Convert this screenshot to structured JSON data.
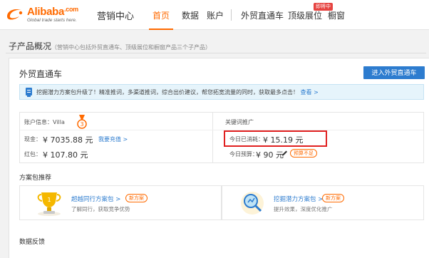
{
  "header": {
    "logo_text": "Alibaba",
    "logo_suffix": ".com",
    "logo_tagline": "Global trade starts here.",
    "app_name": "营销中心",
    "nav": [
      {
        "label": "首页",
        "active": true
      },
      {
        "label": "数据",
        "active": false
      },
      {
        "label": "账户",
        "active": false
      },
      {
        "label": "外贸直通车",
        "active": false
      },
      {
        "label": "顶级展位",
        "active": false
      },
      {
        "label": "橱窗",
        "active": false
      }
    ],
    "nav_badge": "即将中"
  },
  "page": {
    "title": "子产品概况",
    "subtitle": "（营销中心包括外贸直通车、顶级展位和橱窗产品三个子产品）"
  },
  "panel": {
    "title": "外贸直通车",
    "enter_button": "进入外贸直通车",
    "tip_text": "挖掘潜力方案包升级了！精准推词，多渠道推词，综合出价建议，帮您拓宽流量的同时，获取最多点击！",
    "tip_link": "查看 >"
  },
  "account": {
    "info_label": "账户信息：",
    "username": "Villa",
    "cash_label": "现金：",
    "cash_value": "¥ 7035.88 元",
    "recharge_link": "我要充值 >",
    "bonus_label": "红包：",
    "bonus_value": "¥ 107.80 元",
    "keyword_label": "关键词推广",
    "spent_label": "今日已消耗：",
    "spent_value": "¥ 15.19 元",
    "budget_label": "今日预算：",
    "budget_value": "¥ 90 元",
    "budget_tag": "预算不足"
  },
  "recommend": {
    "title": "方案包推荐",
    "items": [
      {
        "name": "超越同行方案包 >",
        "tag": "新方案",
        "desc": "了解同行，获取竞争优势",
        "icon": "trophy-icon"
      },
      {
        "name": "挖掘潜力方案包 >",
        "tag": "新方案",
        "desc": "提升效果，深度优化推广",
        "icon": "magnifier-icon"
      }
    ]
  },
  "data_feedback": {
    "title": "数据反馈"
  },
  "colors": {
    "brand_orange": "#ff6a00",
    "link_blue": "#2d7ccf",
    "highlight_red": "#e02020"
  }
}
